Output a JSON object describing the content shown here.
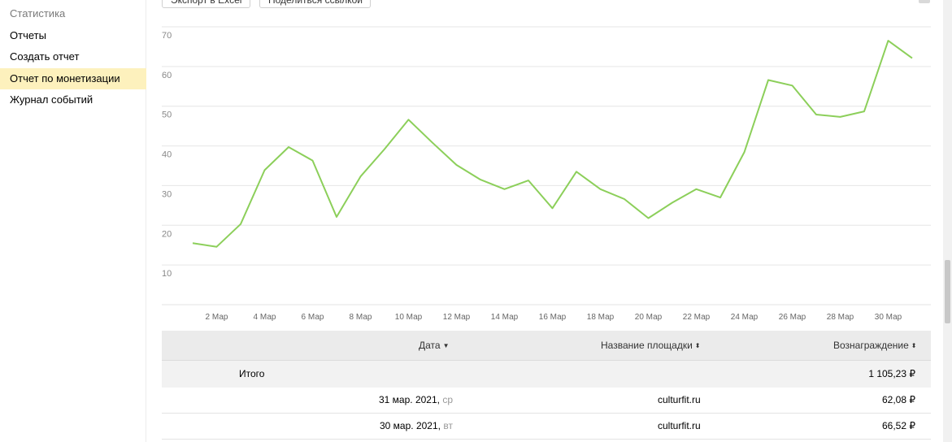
{
  "sidebar": {
    "section_title": "Статистика",
    "items": [
      {
        "label": "Отчеты",
        "active": false
      },
      {
        "label": "Создать отчет",
        "active": false
      },
      {
        "label": "Отчет по монетизации",
        "active": true
      },
      {
        "label": "Журнал событий",
        "active": false
      }
    ]
  },
  "toolbar": {
    "export_label": "Экспорт в Excel",
    "share_label": "Поделиться ссылкой"
  },
  "chart_data": {
    "type": "line",
    "title": "",
    "xlabel": "",
    "ylabel": "",
    "ylim": [
      0,
      70
    ],
    "y_ticks": [
      10,
      20,
      30,
      40,
      50,
      60,
      70
    ],
    "grid": true,
    "line_color": "#8ccf5a",
    "x_tick_labels": [
      "2 Мар",
      "4 Мар",
      "6 Мар",
      "8 Мар",
      "10 Мар",
      "12 Мар",
      "14 Мар",
      "16 Мар",
      "18 Мар",
      "20 Мар",
      "22 Мар",
      "24 Мар",
      "26 Мар",
      "28 Мар",
      "30 Мар"
    ],
    "x": [
      "1 Мар",
      "2 Мар",
      "3 Мар",
      "4 Мар",
      "5 Мар",
      "6 Мар",
      "7 Мар",
      "8 Мар",
      "9 Мар",
      "10 Мар",
      "11 Мар",
      "12 Мар",
      "13 Мар",
      "14 Мар",
      "15 Мар",
      "16 Мар",
      "17 Мар",
      "18 Мар",
      "19 Мар",
      "20 Мар",
      "21 Мар",
      "22 Мар",
      "23 Мар",
      "24 Мар",
      "25 Мар",
      "26 Мар",
      "27 Мар",
      "28 Мар",
      "29 Мар",
      "30 Мар",
      "31 Мар"
    ],
    "values": [
      15.5,
      14.6,
      20.3,
      33.9,
      39.7,
      36.3,
      22.1,
      32.3,
      39.2,
      46.6,
      40.8,
      35.2,
      31.5,
      29.1,
      31.3,
      24.3,
      33.5,
      29.1,
      26.6,
      21.8,
      25.7,
      29.1,
      27.0,
      38.4,
      56.6,
      55.2,
      47.9,
      47.3,
      48.7,
      66.5,
      62.1
    ]
  },
  "table": {
    "headers": {
      "date": "Дата",
      "site": "Название площадки",
      "reward": "Вознаграждение"
    },
    "total": {
      "label": "Итого",
      "value": "1 105,23 ₽"
    },
    "rows": [
      {
        "date": "31 мар. 2021,",
        "weekday": "ср",
        "site": "culturfit.ru",
        "reward": "62,08 ₽"
      },
      {
        "date": "30 мар. 2021,",
        "weekday": "вт",
        "site": "culturfit.ru",
        "reward": "66,52 ₽"
      }
    ]
  },
  "colors": {
    "accent_active": "#fdf1bd",
    "chart_line": "#8ccf5a"
  }
}
